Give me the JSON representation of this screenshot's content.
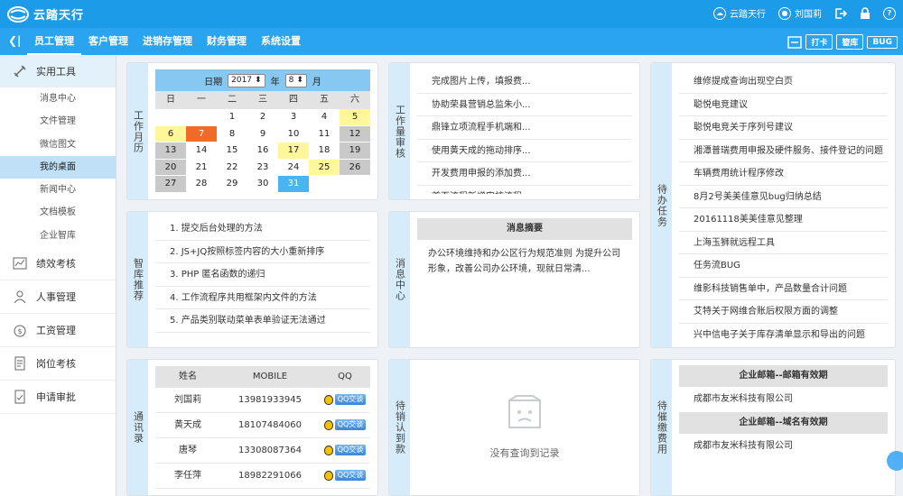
{
  "app": {
    "name": "云踏天行"
  },
  "topbar": {
    "user_name": "刘国莉",
    "app_link": "云踏天行",
    "help": "?"
  },
  "nav": {
    "items": [
      "员工管理",
      "客户管理",
      "进销存管理",
      "财务管理",
      "系统设置"
    ],
    "active": 0,
    "right_buttons": [
      "打卡",
      "簪库",
      "BUG"
    ]
  },
  "sidebar": {
    "groups": [
      {
        "label": "实用工具",
        "icon": "tools-icon",
        "subs": [
          "消息中心",
          "文件管理",
          "微信图文",
          "我的桌面",
          "新闻中心",
          "文档模板",
          "企业智库"
        ]
      },
      {
        "label": "绩效考核",
        "icon": "chart-icon"
      },
      {
        "label": "人事管理",
        "icon": "person-icon"
      },
      {
        "label": "工资管理",
        "icon": "money-icon"
      },
      {
        "label": "岗位考核",
        "icon": "doc-icon"
      },
      {
        "label": "申请审批",
        "icon": "approve-icon"
      }
    ],
    "active_sub": "我的桌面"
  },
  "calendar": {
    "tab": "工作月历",
    "year_label": "日期",
    "year": "2017",
    "month": "8",
    "month_label": "月",
    "dow": [
      "日",
      "一",
      "二",
      "三",
      "四",
      "五",
      "六"
    ],
    "rows": [
      [
        "",
        "",
        "1",
        "2",
        "3",
        "4",
        "5"
      ],
      [
        "6",
        "7",
        "8",
        "9",
        "10",
        "11",
        "12"
      ],
      [
        "13",
        "14",
        "15",
        "16",
        "17",
        "18",
        "19"
      ],
      [
        "20",
        "21",
        "22",
        "23",
        "24",
        "25",
        "26"
      ],
      [
        "27",
        "28",
        "29",
        "30",
        "31",
        "",
        ""
      ]
    ]
  },
  "workload": {
    "tab": "工作量审核",
    "items": [
      "完成图片上传，填报费...",
      "协助荣县营销总监朱小...",
      "鼎锋立项流程手机端和...",
      "使用黄天成的拖动排序...",
      "开发费用申报的添加费...",
      "首页流程新增审核流程..."
    ]
  },
  "todo": {
    "tab": "待办任务",
    "items": [
      "维修提成查询出现空白页",
      "聪悦电竞建议",
      "聪悦电竞关于序列号建议",
      "湘潭普瑞费用申报及硬件服务、接件登记的问题",
      "车辆费用统计程序修改",
      "8月2号美美佳意见bug归纳总结",
      "20161118美美佳意见整理",
      "上海玉狮就远程工具",
      "任务流BUG",
      "维影科技销售单中，产品数量合计问题",
      "艾特关于网维合账后权限方面的调整",
      "兴中信电子关于库存清单显示和导出的问题"
    ]
  },
  "knowledge": {
    "tab": "智库推荐",
    "items": [
      "1. 提交后台处理的方法",
      "2. JS+JQ按照标签内容的大小重新排序",
      "3. PHP 匿名函数的递归",
      "4. 工作流程序共用框架内文件的方法",
      "5. 产品类别联动菜单表单验证无法通过"
    ]
  },
  "messages": {
    "tab": "消息中心",
    "title": "消息摘要",
    "body": "办公环境维持和办公区行为规范准则 为提升公司形象，改善公司办公环境，现就日常清..."
  },
  "contacts": {
    "tab": "通讯录",
    "headers": [
      "姓名",
      "MOBILE",
      "QQ"
    ],
    "qq_label": "QQ交谈",
    "rows": [
      [
        "刘国莉",
        "13981933945"
      ],
      [
        "黄天成",
        "18107484060"
      ],
      [
        "唐琴",
        "13308087364"
      ],
      [
        "李任萍",
        "18982291066"
      ]
    ]
  },
  "reimburse": {
    "tab": "待销认到款",
    "empty": "没有查询到记录"
  },
  "fees": {
    "tab": "待催缴费用",
    "sections": [
      {
        "title": "企业邮箱--邮箱有效期",
        "value": "成都市友米科技有限公司"
      },
      {
        "title": "企业邮箱--域名有效期",
        "value": "成都市友米科技有限公司"
      }
    ]
  },
  "colors": {
    "primary": "#1c9be8",
    "nav": "#2aa4ee",
    "today": "#f06a2a",
    "highlight": "#fff79a",
    "selected": "#49b4f0"
  }
}
